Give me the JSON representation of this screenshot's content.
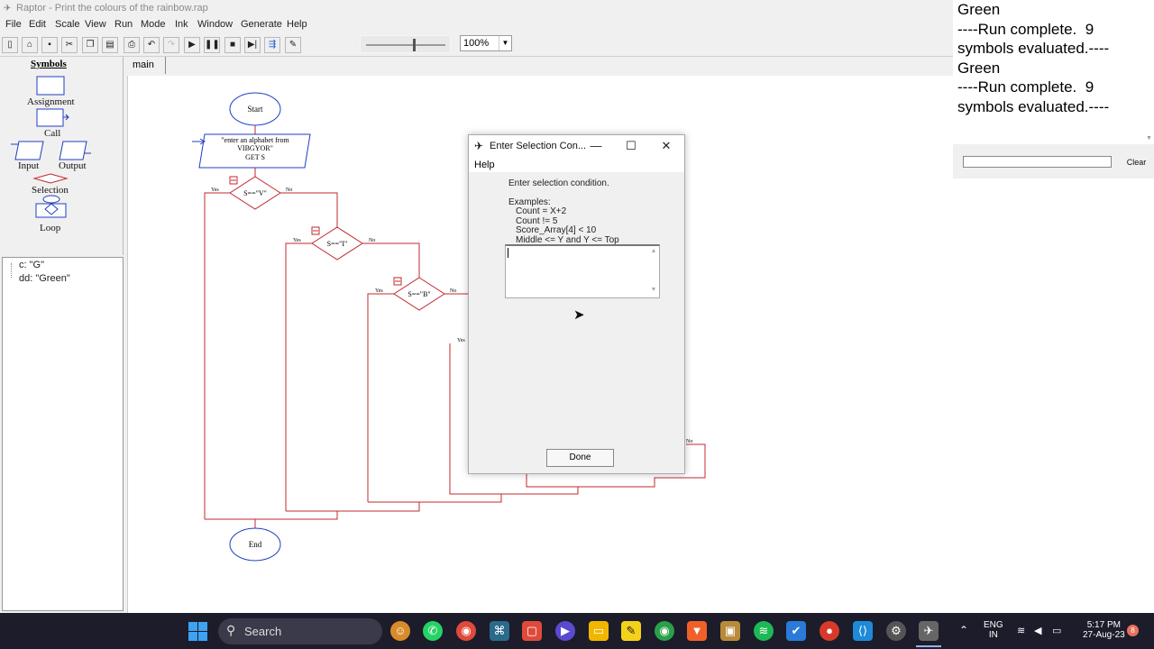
{
  "window": {
    "title": "Raptor - Print the colours of the rainbow.rap"
  },
  "menu": [
    "File",
    "Edit",
    "Scale",
    "View",
    "Run",
    "Mode",
    "Ink",
    "Window",
    "Generate",
    "Help"
  ],
  "toolbar": {
    "zoom": "100%"
  },
  "palette": {
    "title": "Symbols",
    "items": [
      "Assignment",
      "Call",
      "Input",
      "Output",
      "Selection",
      "Loop"
    ]
  },
  "variables": [
    "c: \"G\"",
    "dd: \"Green\""
  ],
  "tab": {
    "label": "main"
  },
  "flowchart": {
    "start": "Start",
    "end": "End",
    "input_line1": "\"enter an alphabet from",
    "input_line2": "VIBGYOR\"",
    "input_line3": "GET S",
    "cond1": "S==\"V\"",
    "cond2": "S==\"I\"",
    "cond3": "S==\"B\"",
    "yes": "Yes",
    "no": "No"
  },
  "console": {
    "lines": [
      "Green",
      "----Run complete.  9",
      "symbols evaluated.----",
      "Green",
      "----Run complete.  9",
      "symbols evaluated.----"
    ],
    "clear_label": "Clear"
  },
  "dialog": {
    "title": "Enter Selection Con...",
    "menu": "Help",
    "prompt": "Enter selection condition.",
    "examples_label": "Examples:",
    "examples": [
      "Count = X+2",
      "Count != 5",
      "Score_Array[4] < 10",
      "Middle <= Y and Y <= Top"
    ],
    "input_value": "",
    "done_label": "Done"
  },
  "taskbar": {
    "search_placeholder": "Search",
    "lang1": "ENG",
    "lang2": "IN",
    "time": "5:17 PM",
    "date": "27-Aug-23",
    "notif_count": "8"
  }
}
